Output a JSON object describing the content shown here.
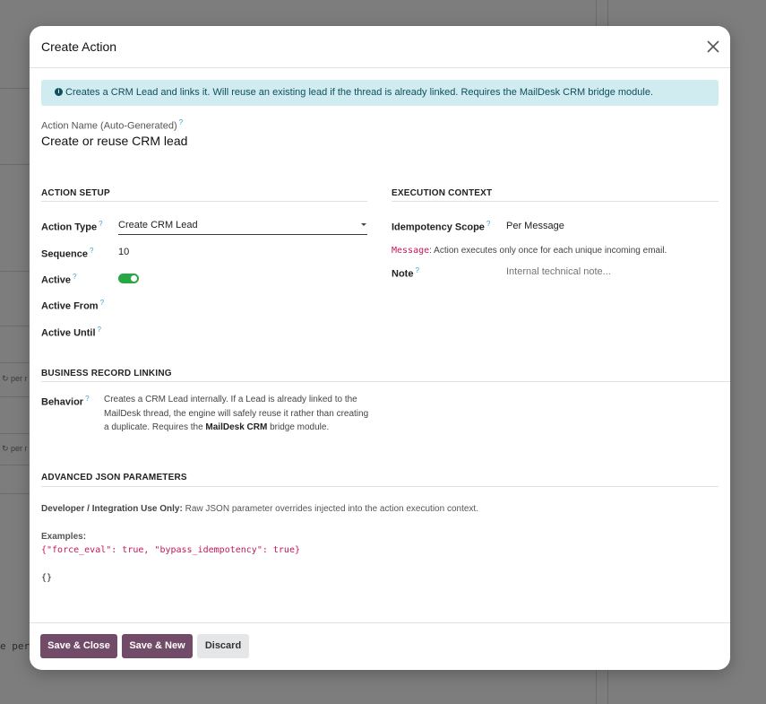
{
  "background": {
    "fragment_a": "per r",
    "fragment_b": "per r",
    "fragment_c": "e per"
  },
  "modal": {
    "title": "Create Action",
    "alert_text": "Creates a CRM Lead and links it. Will reuse an existing lead if the thread is already linked. Requires the MailDesk CRM bridge module.",
    "action_name_label": "Action Name (Auto-Generated)",
    "action_name_value": "Create or reuse CRM lead",
    "help_mark": "?"
  },
  "action_setup": {
    "title": "Action Setup",
    "action_type_label": "Action Type",
    "action_type_value": "Create CRM Lead",
    "sequence_label": "Sequence",
    "sequence_value": "10",
    "active_label": "Active",
    "active_value": true,
    "active_from_label": "Active From",
    "active_from_value": "",
    "active_until_label": "Active Until",
    "active_until_value": ""
  },
  "execution_context": {
    "title": "Execution Context",
    "idempotency_label": "Idempotency Scope",
    "idempotency_value": "Per Message",
    "hint_code": "Message",
    "hint_text": ": Action executes only once for each unique incoming email.",
    "note_label": "Note",
    "note_placeholder": "Internal technical note..."
  },
  "business_linking": {
    "title": "Business Record Linking",
    "behavior_label": "Behavior",
    "behavior_text": "Creates a CRM Lead internally. If a Lead is already linked to the MailDesk thread, the engine will safely reuse it rather than creating a duplicate. Requires the",
    "behavior_bold": "MailDesk CRM",
    "behavior_tail": "bridge module."
  },
  "advanced_json": {
    "title": "Advanced JSON Parameters",
    "dev_label": "Developer / Integration Use Only:",
    "dev_text": " Raw JSON parameter overrides injected into the action execution context.",
    "examples_label": "Examples:",
    "example_code": "{\"force_eval\": true, \"bypass_idempotency\": true}",
    "json_value": "{}"
  },
  "footer": {
    "save_close_label": "Save & Close",
    "save_new_label": "Save & New",
    "discard_label": "Discard"
  },
  "colors": {
    "primary": "#714b67",
    "toggle_on": "#28a745",
    "alert_bg": "#d0ecf0",
    "code_pink": "#c2185b"
  },
  "icons": {
    "close": "close-icon",
    "info": "info-icon",
    "caret": "caret-down-icon"
  }
}
